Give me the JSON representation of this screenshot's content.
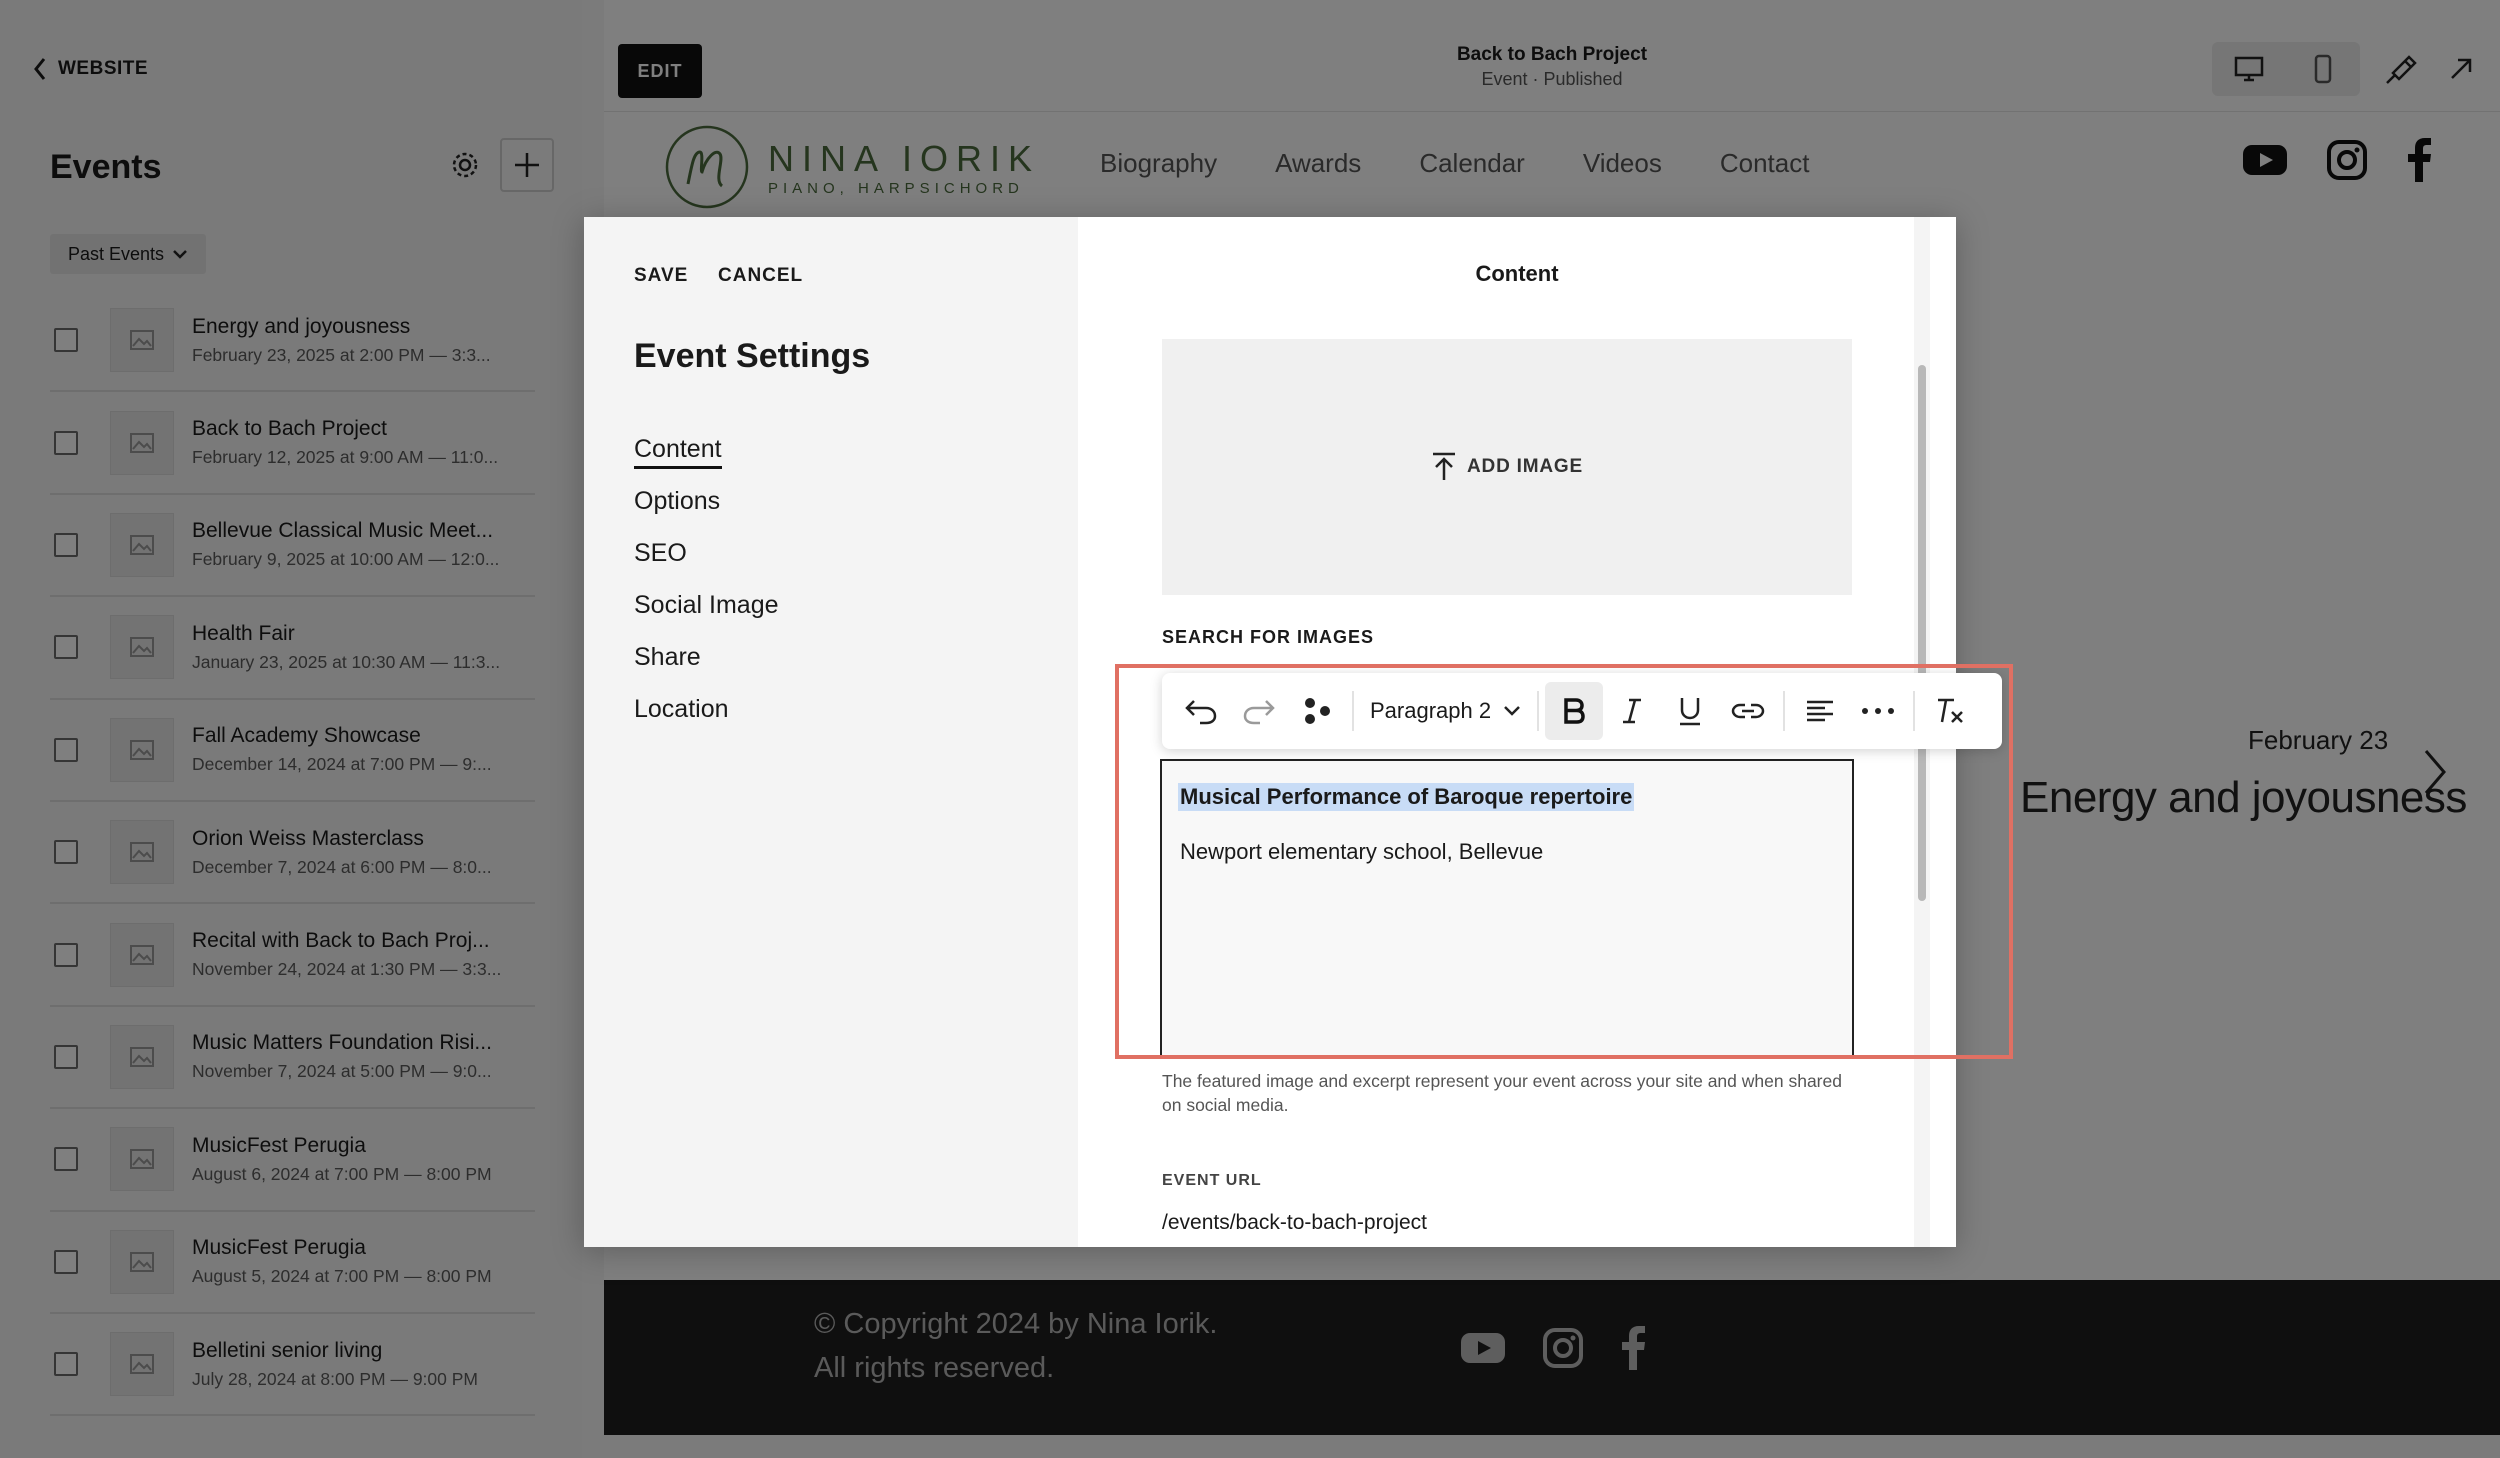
{
  "sidebar": {
    "back_label": "WEBSITE",
    "title": "Events",
    "filter_label": "Past Events",
    "events": [
      {
        "title": "Energy and joyousness",
        "date": "February 23, 2025 at 2:00 PM — 3:3..."
      },
      {
        "title": "Back to Bach Project",
        "date": "February 12, 2025 at 9:00 AM — 11:0..."
      },
      {
        "title": "Bellevue Classical Music Meet...",
        "date": "February 9, 2025 at 10:00 AM — 12:0..."
      },
      {
        "title": "Health Fair",
        "date": "January 23, 2025 at 10:30 AM — 11:3..."
      },
      {
        "title": "Fall Academy Showcase",
        "date": "December 14, 2024 at 7:00 PM — 9:..."
      },
      {
        "title": "Orion Weiss Masterclass",
        "date": "December 7, 2024 at 6:00 PM — 8:0..."
      },
      {
        "title": "Recital with Back to Bach Proj...",
        "date": "November 24, 2024 at 1:30 PM — 3:3..."
      },
      {
        "title": "Music Matters Foundation Risi...",
        "date": "November 7, 2024 at 5:00 PM — 9:0..."
      },
      {
        "title": "MusicFest Perugia",
        "date": "August 6, 2024 at 7:00 PM — 8:00 PM"
      },
      {
        "title": "MusicFest Perugia",
        "date": "August 5, 2024 at 7:00 PM — 8:00 PM"
      },
      {
        "title": "Belletini senior living",
        "date": "July 28, 2024 at 8:00 PM — 9:00 PM"
      }
    ]
  },
  "topbar": {
    "edit_label": "EDIT",
    "page_title": "Back to Bach Project",
    "page_status": "Event · Published"
  },
  "site": {
    "logo_name": "NINA IORIK",
    "logo_tagline": "PIANO, HARPSICHORD",
    "nav": [
      "Biography",
      "Awards",
      "Calendar",
      "Videos",
      "Contact"
    ],
    "hero_date": "February 23",
    "hero_title": "Energy and joyousness",
    "footer_copyright": "© Copyright 2024 by Nina Iorik.",
    "footer_rights": "All rights reserved."
  },
  "modal": {
    "save_label": "SAVE",
    "cancel_label": "CANCEL",
    "title": "Event Settings",
    "menu": [
      "Content",
      "Options",
      "SEO",
      "Social Image",
      "Share",
      "Location"
    ],
    "active_menu": "Content",
    "content_heading": "Content",
    "add_image_label": "ADD IMAGE",
    "search_images_label": "SEARCH FOR IMAGES",
    "excerpt_line1": "Musical Performance of Baroque repertoire",
    "excerpt_line2": "Newport elementary school, Bellevue",
    "excerpt_help": "The featured image and excerpt represent your event across your site and when shared on social media.",
    "event_url_label": "EVENT URL",
    "event_url_value": "/events/back-to-bach-project"
  },
  "toolbar": {
    "paragraph_style": "Paragraph 2",
    "buttons": [
      "undo-icon",
      "redo-icon",
      "blocks-icon",
      "bold-icon",
      "italic-icon",
      "underline-icon",
      "link-icon",
      "align-left-icon",
      "more-icon",
      "clear-format-icon"
    ]
  },
  "colors": {
    "highlight_box": "#e07063",
    "selection": "#c8dcf6",
    "logo_green": "#4a6a3c"
  }
}
